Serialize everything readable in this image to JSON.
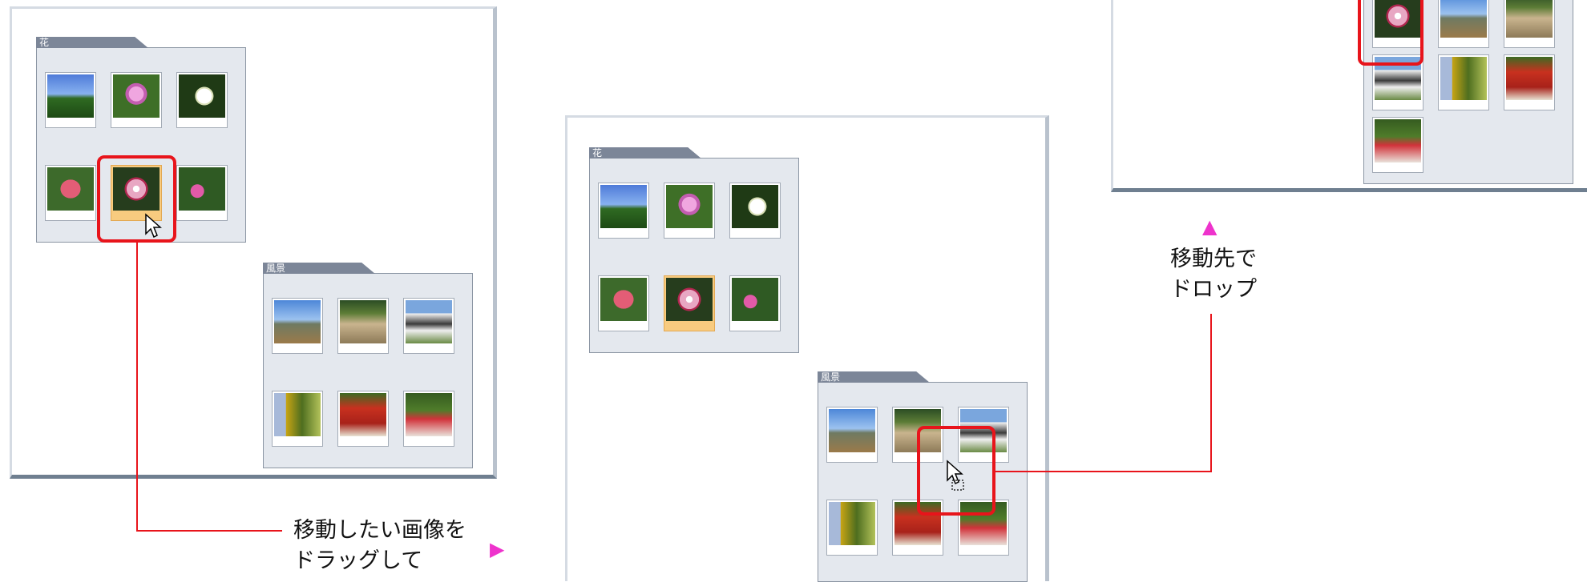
{
  "panel1": {
    "folder_flowers": {
      "title": "花"
    },
    "folder_scenery": {
      "title": "風景"
    }
  },
  "panel2": {
    "folder_flowers": {
      "title": "花"
    },
    "folder_scenery": {
      "title": "風景"
    }
  },
  "annotations": {
    "drag_caption_line1": "移動したい画像を",
    "drag_caption_line2": "ドラッグして",
    "drop_caption_line1": "移動先で",
    "drop_caption_line2": "ドロップ",
    "arrow_right": "▶",
    "arrow_up": "▲",
    "highlight_color": "#e8141b",
    "arrow_color": "#ee33cc"
  },
  "thumbnails": {
    "flowers": [
      "sky-flower",
      "pink-flower",
      "white-flower",
      "red-leaf",
      "lily",
      "pink-cluster"
    ],
    "scenery": [
      "mountains",
      "hill-road",
      "timber-house",
      "street-lamp",
      "red-shrine",
      "tea-umbrella"
    ]
  }
}
